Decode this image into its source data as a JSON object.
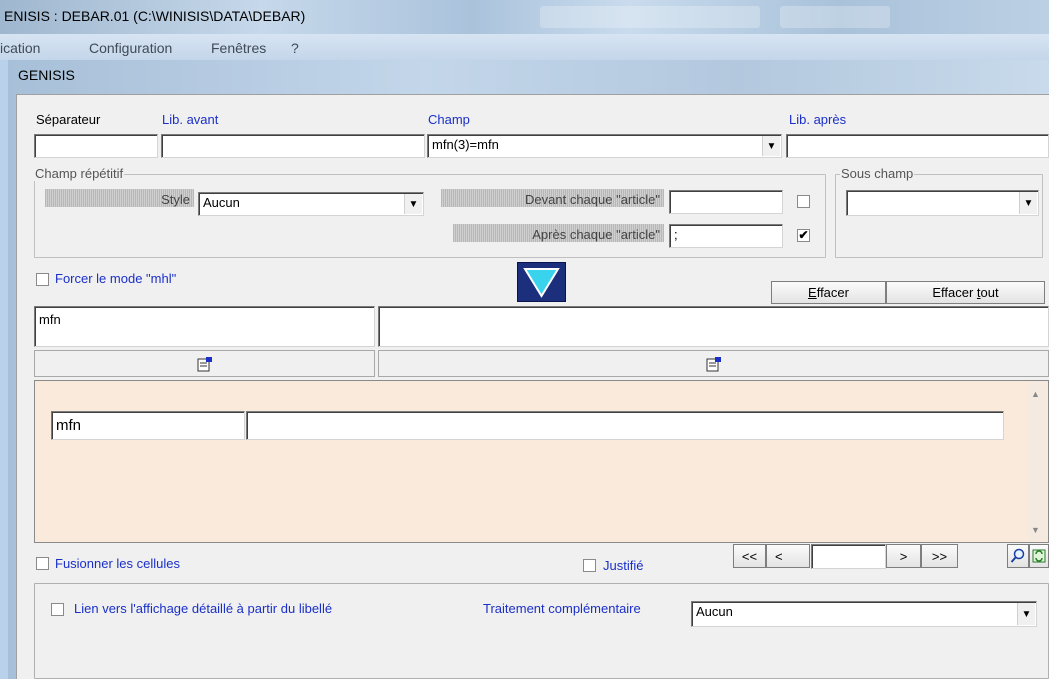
{
  "titlebar": {
    "title": "ENISIS : DEBAR.01 (C:\\WINISIS\\DATA\\DEBAR)"
  },
  "menu": {
    "items": [
      "ication",
      "Configuration",
      "Fenêtres",
      "?"
    ]
  },
  "child": {
    "title": "GENISIS"
  },
  "labels": {
    "separateur": "Séparateur",
    "lib_avant": "Lib. avant",
    "champ": "Champ",
    "lib_apres": "Lib. après"
  },
  "fields": {
    "separateur_value": "",
    "lib_avant_value": "",
    "champ_value": "mfn(3)=mfn",
    "lib_apres_value": ""
  },
  "champ_repetitif": {
    "legend": "Champ répétitif",
    "style_label": "Style",
    "style_value": "Aucun",
    "devant_label": "Devant chaque \"article\"",
    "devant_value": "",
    "devant_checked": false,
    "apres_label": "Après chaque \"article\"",
    "apres_value": ";",
    "apres_checked": true
  },
  "sous_champ": {
    "legend": "Sous champ",
    "value": ""
  },
  "forcer": {
    "label": "Forcer le mode \"mhl\"",
    "checked": false
  },
  "buttons": {
    "effacer_first": "E",
    "effacer_rest": "ffacer",
    "effacer_tout_prefix": "Effacer ",
    "effacer_tout_u": "t",
    "effacer_tout_rest": "out"
  },
  "expression": {
    "left": "mfn",
    "right": ""
  },
  "preview": {
    "cell_left": "mfn",
    "cell_right": ""
  },
  "options": {
    "fusionner_label": "Fusionner les cellules",
    "fusionner_checked": false,
    "justifie_label": "Justifié",
    "justifie_checked": false,
    "nav_first": "<<",
    "nav_prev": "<",
    "nav_value": "",
    "nav_next": ">",
    "nav_last": ">>"
  },
  "bottom": {
    "lien_label": "Lien vers l'affichage détaillé à partir du libellé",
    "lien_checked": false,
    "traitement_label": "Traitement complémentaire",
    "traitement_value": "Aucun"
  },
  "colors": {
    "preview_bg": "#faeadc",
    "blue_label": "#1a2fc8",
    "arrow_button": "#1b2f7c",
    "arrow_fill": "#39d3ee"
  }
}
